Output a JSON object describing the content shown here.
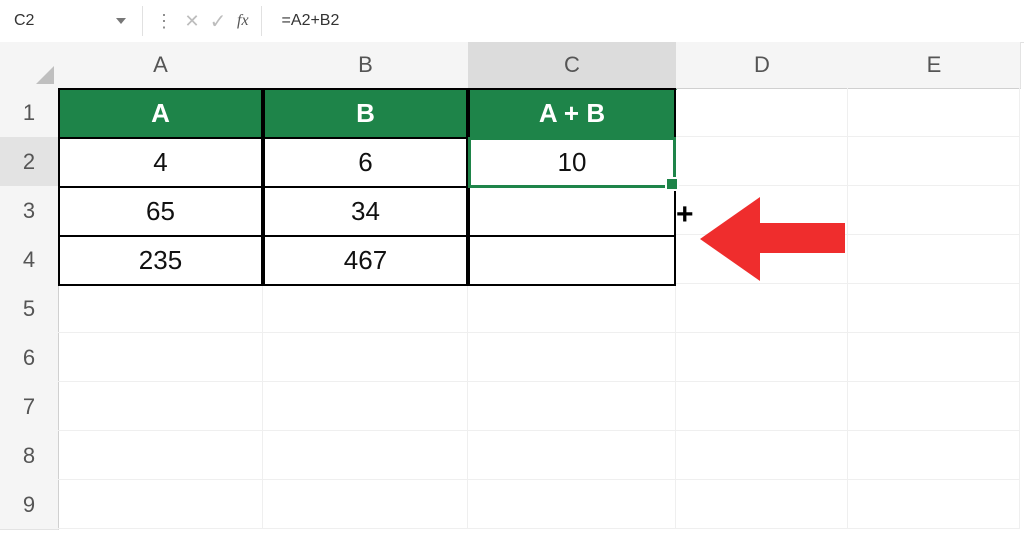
{
  "formula_bar": {
    "name_box": "C2",
    "fx_label": "fx",
    "formula": "=A2+B2"
  },
  "columns": {
    "A": "A",
    "B": "B",
    "C": "C",
    "D": "D",
    "E": "E"
  },
  "rows": {
    "1": "1",
    "2": "2",
    "3": "3",
    "4": "4",
    "5": "5",
    "6": "6",
    "7": "7",
    "8": "8",
    "9": "9"
  },
  "table": {
    "header": {
      "A": "A",
      "B": "B",
      "C": "A + B"
    },
    "r2": {
      "A": "4",
      "B": "6",
      "C": "10"
    },
    "r3": {
      "A": "65",
      "B": "34",
      "C": ""
    },
    "r4": {
      "A": "235",
      "B": "467",
      "C": ""
    }
  },
  "selection": {
    "cell": "C2"
  },
  "annotation": {
    "arrow": "fill-handle-pointer"
  }
}
